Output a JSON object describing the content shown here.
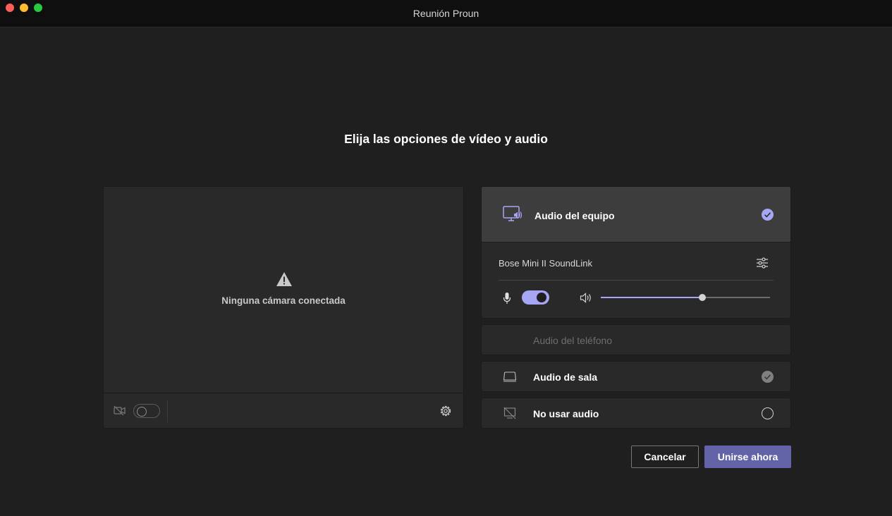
{
  "window": {
    "title": "Reunión Proun"
  },
  "heading": "Elija las opciones de vídeo y audio",
  "video": {
    "status": "Ninguna cámara conectada",
    "camera_on": false
  },
  "audio": {
    "computer": {
      "label": "Audio del equipo",
      "selected": true,
      "device_name": "Bose Mini II SoundLink",
      "mic_on": true,
      "volume_percent": 60
    },
    "phone": {
      "label": "Audio del teléfono",
      "enabled": false
    },
    "room": {
      "label": "Audio de sala",
      "selected": false
    },
    "none": {
      "label": "No usar audio",
      "selected": false
    }
  },
  "actions": {
    "cancel_label": "Cancelar",
    "join_label": "Unirse ahora"
  },
  "colors": {
    "accent": "#a6a6f4",
    "primary_button": "#6264a7",
    "background": "#1f1f1f",
    "panel": "#292929"
  },
  "icons": [
    "warning-icon",
    "camera-off-icon",
    "gear-icon",
    "monitor-speaker-icon",
    "check-circle-icon",
    "sliders-icon",
    "microphone-icon",
    "volume-icon",
    "room-device-icon",
    "no-audio-icon"
  ]
}
